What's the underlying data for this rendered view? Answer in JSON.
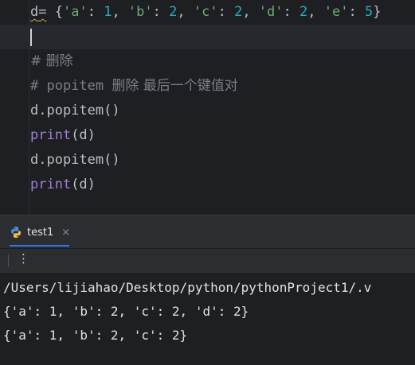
{
  "editor": {
    "line1": {
      "var": "d",
      "assign": "=",
      "open": " {",
      "k1": "'a'",
      "v1": "1",
      "k2": "'b'",
      "v2": "2",
      "k3": "'c'",
      "v3": "2",
      "k4": "'d'",
      "v4": "2",
      "k5": "'e'",
      "v5": "5",
      "colon": ": ",
      "comma": ", ",
      "close": "}"
    },
    "comment1": "# 删除",
    "comment2_hash": "# popitem ",
    "comment2_text": "删除 最后一个键值对",
    "line_popitem1": "d.popitem()",
    "print1_kw": "print",
    "print1_args": "(d)",
    "line_popitem2": "d.popitem()",
    "print2_kw": "print",
    "print2_args": "(d)"
  },
  "run_panel": {
    "tab_label": "test1",
    "close_glyph": "×",
    "kebab_glyph": "⋮"
  },
  "console": {
    "lines": [
      "/Users/lijiahao/Desktop/python/pythonProject1/.v",
      "{'a': 1, 'b': 2, 'c': 2, 'd': 2}",
      "{'a': 1, 'b': 2, 'c': 2}"
    ]
  },
  "colors": {
    "string": "#6aab73",
    "number": "#2aacb8",
    "keyword": "#9f7fd1",
    "comment": "#7a7e85",
    "accent": "#3574f0"
  }
}
